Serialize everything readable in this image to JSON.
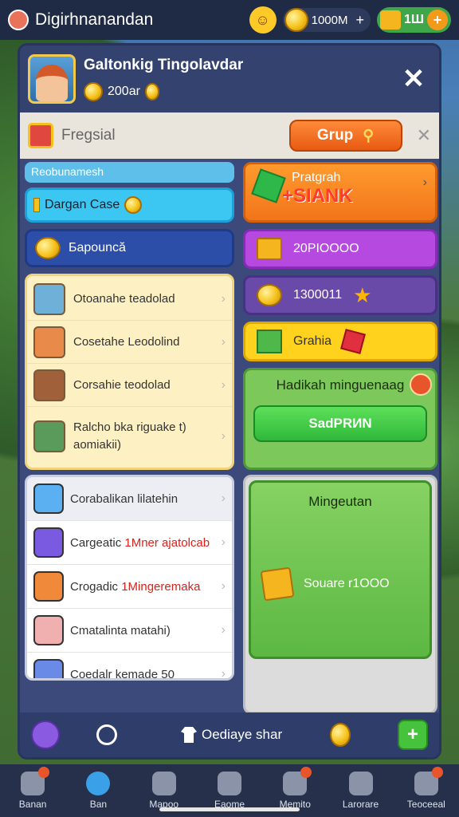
{
  "topbar": {
    "app_title": "Digirhnanandan",
    "coins": "1000M",
    "gems": "1Ш"
  },
  "panel": {
    "title": "Galtonkig Tingolavdar",
    "coins": "200ar",
    "strip_label": "Fregsial",
    "group_button": "Grup",
    "left_header": "Reobunamesh",
    "cyan_label": "Dargan Case",
    "blue_label": "Бapouncă",
    "yellow_items": [
      {
        "label": "Otoanahe teadolad"
      },
      {
        "label": "Cosetahe Leodolind"
      },
      {
        "label": "Corsahie teodolad"
      },
      {
        "label": "Ralcho bka riguake t) aomiakii)"
      }
    ],
    "orange_title": "Pratgrah",
    "orange_big": "+SIANK",
    "purple_pill": "20PIOOOO",
    "dpurple_pill": "1300011",
    "yellow_pill": "Grahia",
    "green_box_title": "Hadikah minguenaag",
    "green_button": "SadPRИN",
    "white_items": [
      {
        "label": "Corabalikan lilatehin",
        "extra": ""
      },
      {
        "label": "Cargeatic ",
        "extra": "1Mner ajatolcab"
      },
      {
        "label": "Crogadic ",
        "extra": "1Mingeremaka"
      },
      {
        "label": "Cmatalinta matahi)",
        "extra": ""
      },
      {
        "label": "Coedalr kemade 50",
        "extra": ""
      }
    ],
    "weekly_title": "Mingeutan",
    "weekly_value": "Souare r1OOO",
    "footer_label": "Oediaye shar"
  },
  "nav": [
    {
      "label": "Banan",
      "icon": "home-icon",
      "dot": true
    },
    {
      "label": "Ban",
      "icon": "globe-icon",
      "dot": false,
      "active": true
    },
    {
      "label": "Mapoo",
      "icon": "map-icon",
      "dot": false
    },
    {
      "label": "Eaome",
      "icon": "shield-icon",
      "dot": false
    },
    {
      "label": "Memito",
      "icon": "bell-icon",
      "dot": true
    },
    {
      "label": "Larorare",
      "icon": "person-icon",
      "dot": false
    },
    {
      "label": "Teoceeal",
      "icon": "dice-icon",
      "dot": true
    }
  ]
}
